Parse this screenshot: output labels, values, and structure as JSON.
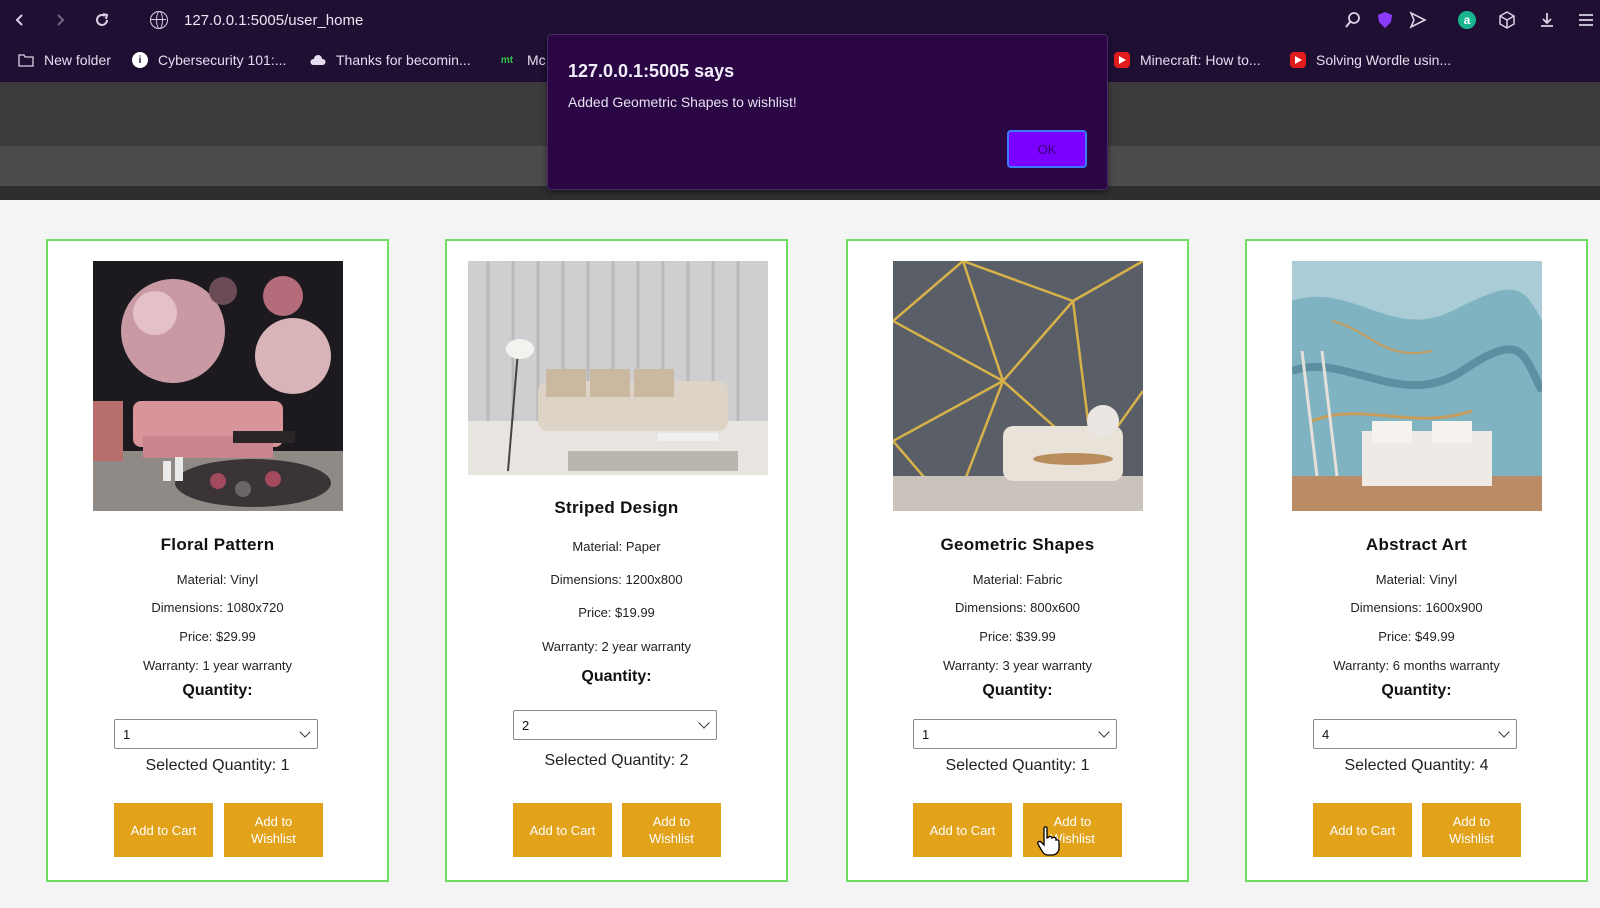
{
  "browser": {
    "url": "127.0.0.1:5005/user_home",
    "bookmarks": [
      "New folder",
      "Cybersecurity 101:...",
      "Thanks for becomin...",
      "Mc",
      "Minecraft: How to...",
      "Solving Wordle usin..."
    ],
    "bookmark_icon_text": {
      "mt": "mt"
    }
  },
  "dialog": {
    "title": "127.0.0.1:5005 says",
    "message": "Added Geometric Shapes to wishlist!",
    "ok_label": "OK"
  },
  "products": [
    {
      "name": "Floral Pattern",
      "material": "Material: Vinyl",
      "dimensions": "Dimensions: 1080x720",
      "price": "Price: $29.99",
      "warranty": "Warranty: 1 year warranty",
      "quantity_label": "Quantity:",
      "quantity_value": "1",
      "selected_quantity": "Selected Quantity: 1",
      "add_to_cart": "Add to Cart",
      "add_to_wishlist": "Add to Wishlist"
    },
    {
      "name": "Striped Design",
      "material": "Material: Paper",
      "dimensions": "Dimensions: 1200x800",
      "price": "Price: $19.99",
      "warranty": "Warranty: 2 year warranty",
      "quantity_label": "Quantity:",
      "quantity_value": "2",
      "selected_quantity": "Selected Quantity: 2",
      "add_to_cart": "Add to Cart",
      "add_to_wishlist": "Add to Wishlist"
    },
    {
      "name": "Geometric Shapes",
      "material": "Material: Fabric",
      "dimensions": "Dimensions: 800x600",
      "price": "Price: $39.99",
      "warranty": "Warranty: 3 year warranty",
      "quantity_label": "Quantity:",
      "quantity_value": "1",
      "selected_quantity": "Selected Quantity: 1",
      "add_to_cart": "Add to Cart",
      "add_to_wishlist": "Add to Wishlist"
    },
    {
      "name": "Abstract Art",
      "material": "Material: Vinyl",
      "dimensions": "Dimensions: 1600x900",
      "price": "Price: $49.99",
      "warranty": "Warranty: 6 months warranty",
      "quantity_label": "Quantity:",
      "quantity_value": "4",
      "selected_quantity": "Selected Quantity: 4",
      "add_to_cart": "Add to Cart",
      "add_to_wishlist": "Add to Wishlist"
    }
  ],
  "colors": {
    "browser_bg": "#1e0f33",
    "card_border": "#6fdc63",
    "button_bg": "#e2a21a",
    "dialog_bg": "#2a0744",
    "ok_button": "#7a00ff"
  },
  "icons": {
    "back": "back-arrow-icon",
    "forward": "forward-arrow-icon",
    "reload": "reload-icon",
    "site": "globe-icon",
    "zoom": "zoom-icon",
    "shield": "shield-icon",
    "send": "send-icon",
    "account": "account-icon",
    "extensions": "cube-icon",
    "download": "download-icon",
    "menu": "menu-icon"
  }
}
